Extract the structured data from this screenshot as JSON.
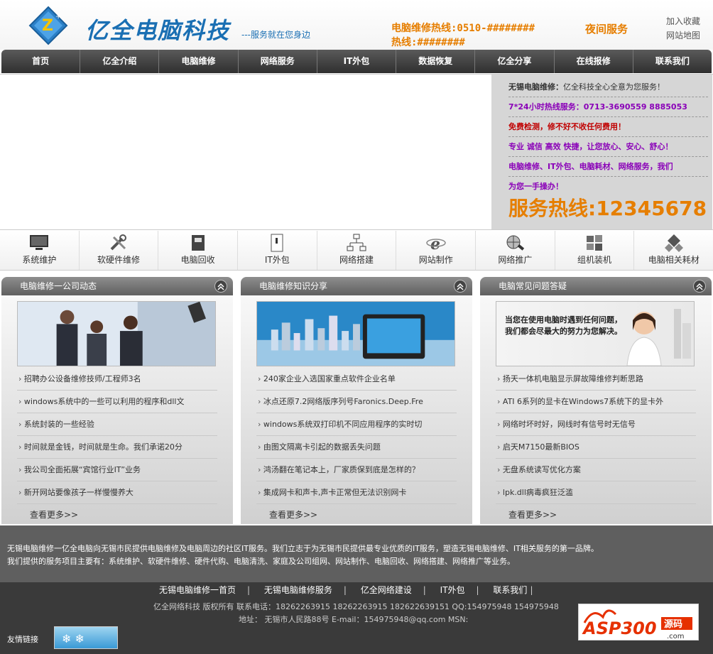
{
  "header": {
    "logo_text": "亿全电脑科技",
    "slogan": "---服务就在您身边",
    "hotline_line1": "电脑维修热线:0510-########",
    "hotline_line2": "热线:########",
    "night_service": "夜间服务",
    "add_favorite": "加入收藏",
    "site_map": "网站地图"
  },
  "nav": [
    "首页",
    "亿全介绍",
    "电脑维修",
    "网络服务",
    "IT外包",
    "数据恢复",
    "亿全分享",
    "在线报修",
    "联系我们"
  ],
  "banner_side": {
    "line1_bold": "无锡电脑维修：",
    "line1_rest": "亿全科技全心全意为您服务！",
    "line2": "7*24小时热线服务：0713-3690559 8885053",
    "line3": "免费检测，修不好不收任何费用！",
    "line4": "专业 诚信 高效 快捷，让您放心、安心、舒心！",
    "line5": "电脑维修、IT外包、电脑耗材、网络服务，我们",
    "line6": "为您一手操办！",
    "big_hotline": "服务热线:12345678"
  },
  "services": [
    {
      "label": "系统维护",
      "icon": "monitor-icon"
    },
    {
      "label": "软硬件维修",
      "icon": "tools-icon"
    },
    {
      "label": "电脑回收",
      "icon": "recycle-box-icon"
    },
    {
      "label": "IT外包",
      "icon": "document-icon"
    },
    {
      "label": "网络搭建",
      "icon": "network-icon"
    },
    {
      "label": "网站制作",
      "icon": "ie-icon"
    },
    {
      "label": "网络推广",
      "icon": "globe-search-icon"
    },
    {
      "label": "组机装机",
      "icon": "windows-icon"
    },
    {
      "label": "电脑相关耗材",
      "icon": "diamond-icon"
    }
  ],
  "columns": [
    {
      "title": "电脑维修一公司动态",
      "items": [
        "招聘办公设备维修技师/工程师3名",
        "windows系统中的一些可以利用的程序和dll文",
        "系统封装的一些经验",
        "时间就是金钱，时间就是生命。我们承诺20分",
        "我公司全面拓展“宾馆行业IT”业务",
        "新开网站要像孩子一样慢慢养大"
      ],
      "more": "查看更多>>"
    },
    {
      "title": "电脑维修知识分享",
      "items": [
        "240家企业入选国家重点软件企业名单",
        "冰点还原7.2网络版序列号Faronics.Deep.Fre",
        "windows系统双打印机不同应用程序的实时切",
        "由图文隔离卡引起的数据丢失问题",
        "鸿汤翻在笔记本上，厂家质保到底是怎样的？",
        "集成网卡和声卡,声卡正常但无法识别网卡"
      ],
      "more": "查看更多>>"
    },
    {
      "title": "电脑常见问题答疑",
      "image_text_1": "当您在使用电脑时遇到任何问题，",
      "image_text_2": "我们都会尽最大的努力为您解决。",
      "items": [
        "扬天一体机电脑显示屏故障维修判断思路",
        "ATI 6系列的显卡在Windows7系统下的显卡外",
        "网络时坏时好，网线时有信号时无信号",
        "启天M7150最新BIOS",
        "无盘系统读写优化方案",
        "lpk.dll病毒疯狂泛滥"
      ],
      "more": "查看更多>>"
    }
  ],
  "footer": {
    "about_1": "无锡电脑维修一亿全电脑向无锡市民提供电脑维修及电脑周边的社区IT服务。我们立志于为无锡市民提供最专业优质的IT服务，塑造无锡电脑维修、IT相关服务的第一品牌。",
    "about_2": "我们提供的服务项目主要有：系统维护、软硬件维修、硬件代购、电脑清洗、家庭及公司组网、网站制作、电脑回收、网络搭建、网络推广等业务。",
    "links": [
      "无锡电脑维修一首页",
      "无锡电脑维修服务",
      "亿全网络建设",
      "IT外包",
      "联系我们"
    ],
    "copyright": "亿全网络科技 版权所有    联系电话：18262263915 18262263915 182622639151   QQ:154975948  154975948",
    "address": "地址： 无锡市人民路88号  E-mail：154975948@qq.com  MSN:",
    "friend_links": "友情链接",
    "asp_logo_text": "ASP300",
    "asp_logo_sub": "源码",
    "asp_logo_domain": ".com"
  },
  "colors": {
    "accent_orange": "#e67e00",
    "brand_blue": "#1a6fb3",
    "purple": "#8a00b8",
    "nav_dark": "#3a3a3a"
  }
}
